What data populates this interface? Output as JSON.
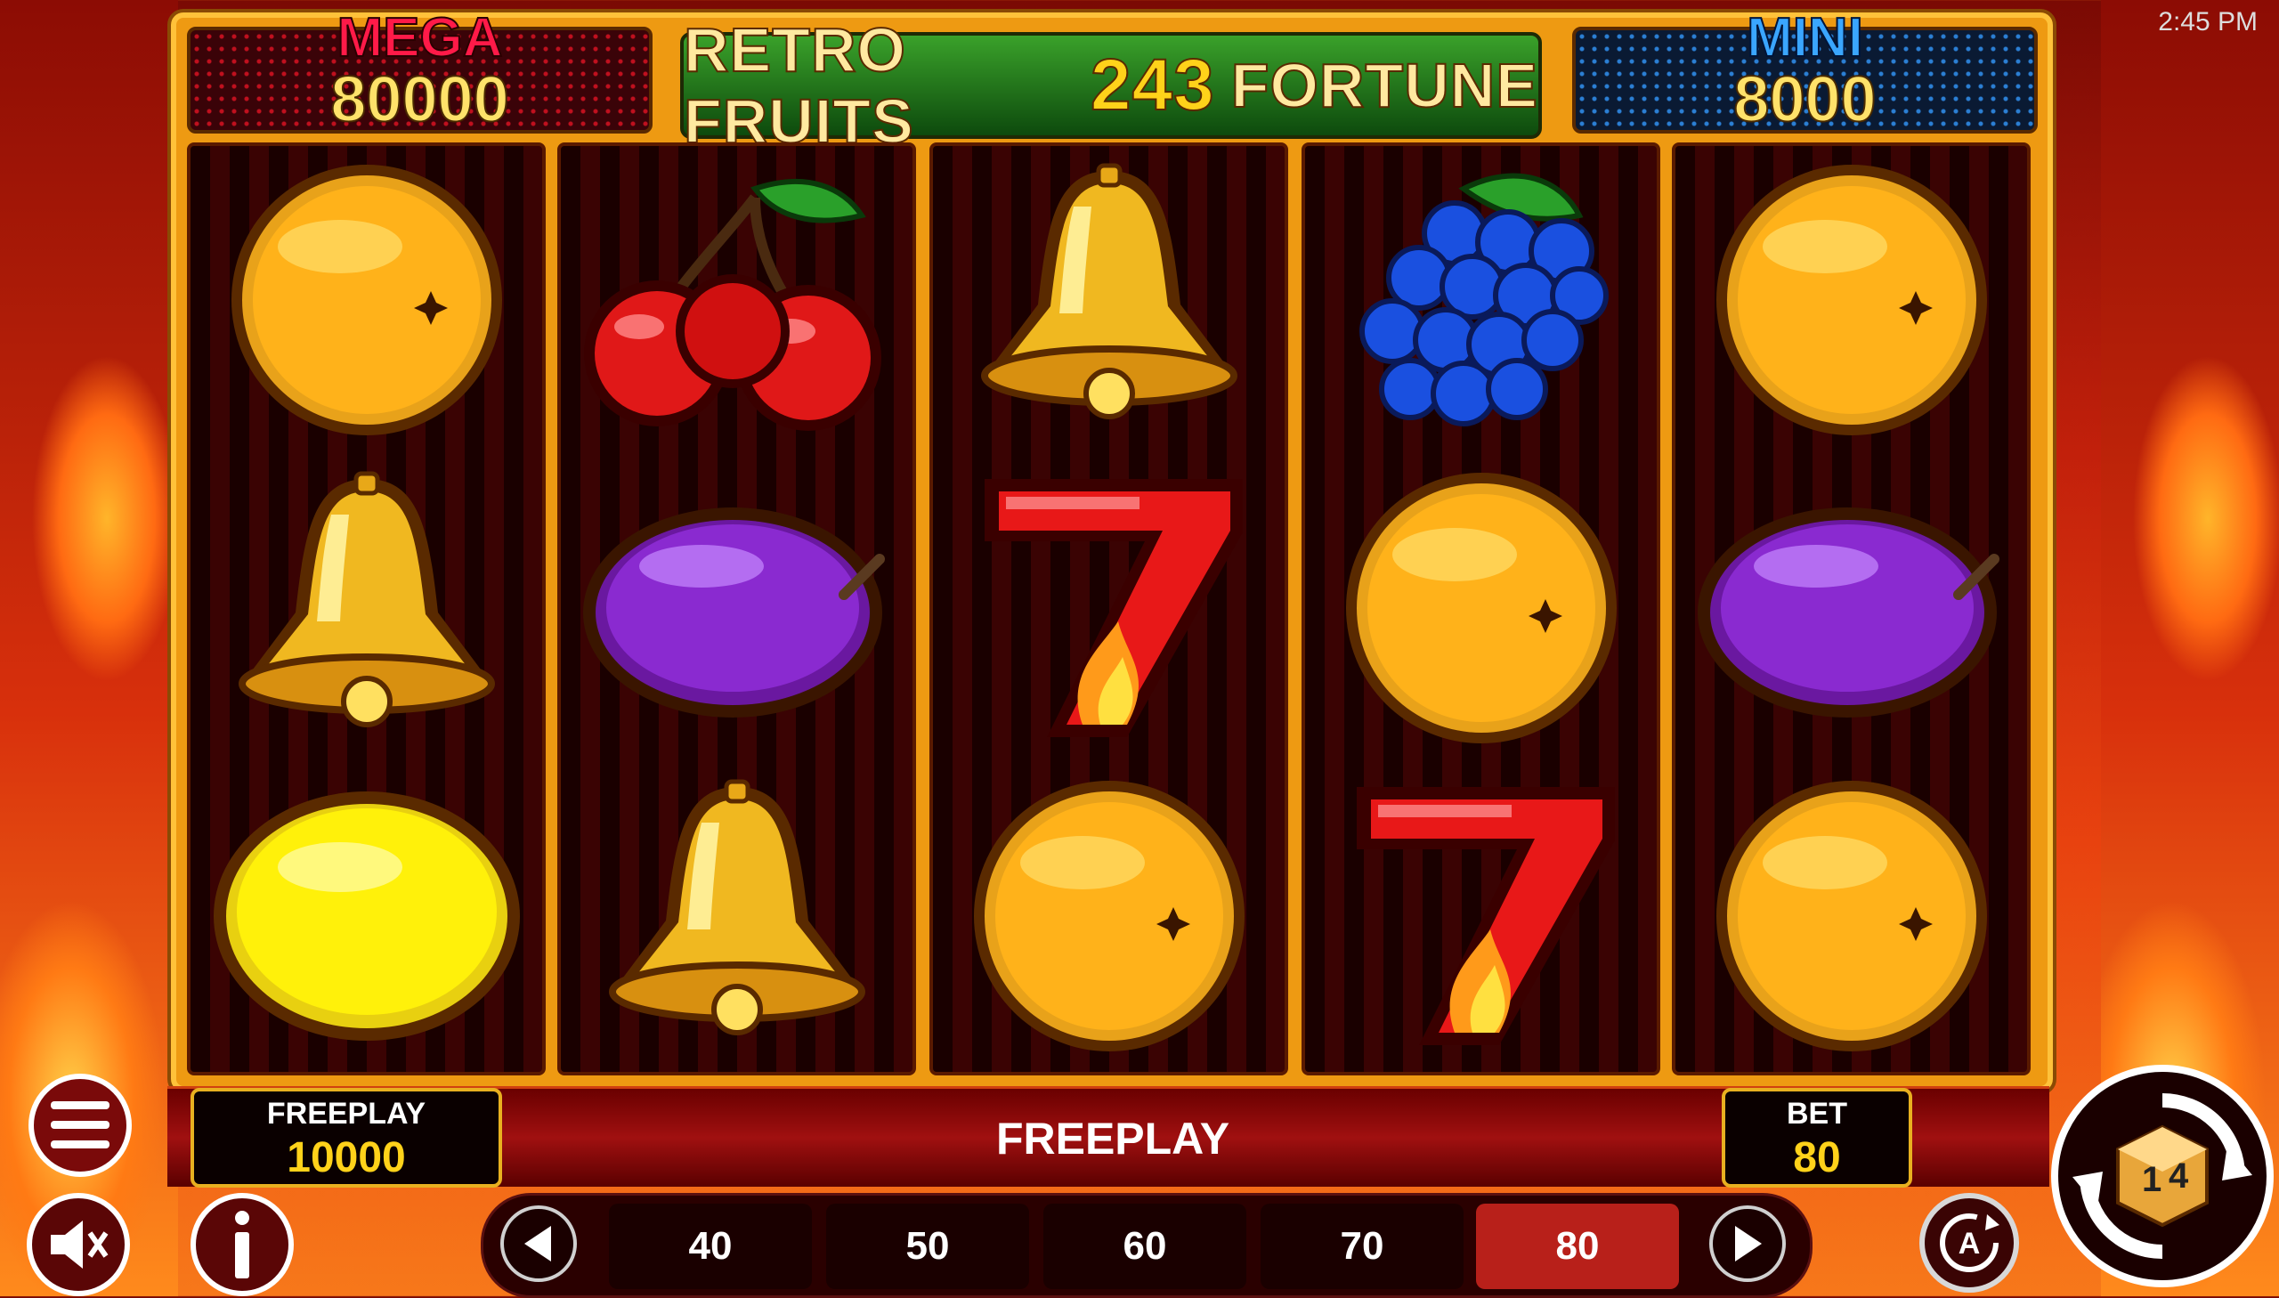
{
  "clock": "2:45 PM",
  "title": {
    "part1": "RETRO FRUITS",
    "part2": "243",
    "part3": "FORTUNE"
  },
  "jackpots": {
    "mega": {
      "label": "MEGA",
      "value": "80000"
    },
    "mini": {
      "label": "MINI",
      "value": "8000"
    }
  },
  "reels": [
    [
      "orange",
      "bell",
      "lemon"
    ],
    [
      "cherries",
      "plum",
      "bell"
    ],
    [
      "bell",
      "seven",
      "orange"
    ],
    [
      "grapes",
      "orange",
      "seven"
    ],
    [
      "orange",
      "plum",
      "orange"
    ]
  ],
  "info": {
    "freeplay_label": "FREEPLAY",
    "freeplay_value": "10000",
    "status": "FREEPLAY",
    "bet_label": "BET",
    "bet_value": "80"
  },
  "bet_options": [
    "40",
    "50",
    "60",
    "70",
    "80"
  ],
  "selected_bet": "80",
  "icons": {
    "menu": "menu-icon",
    "mute": "speaker-muted-icon",
    "info": "info-icon",
    "prev": "arrow-left-icon",
    "next": "arrow-right-icon",
    "autoplay": "autoplay-icon",
    "spin": "spin-icon"
  }
}
